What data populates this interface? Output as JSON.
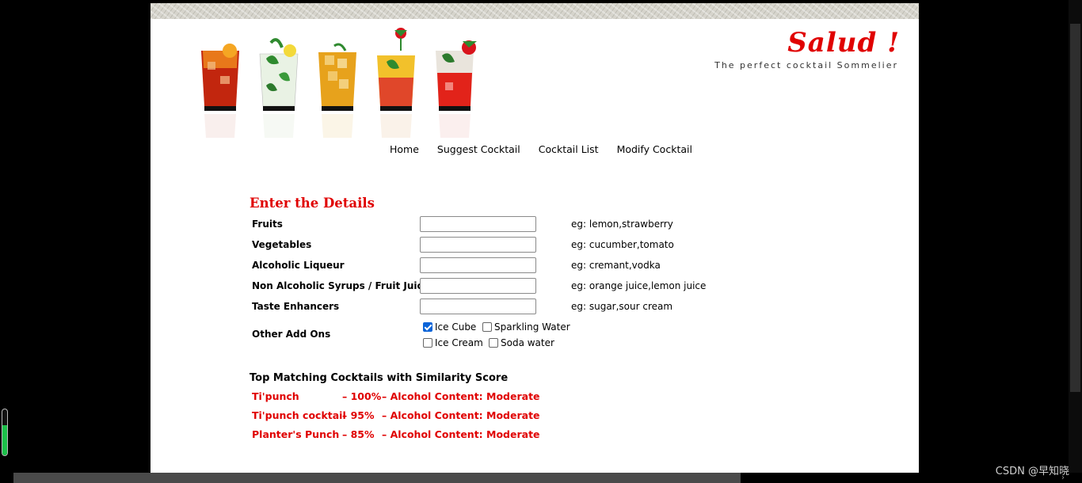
{
  "brand": {
    "title": "Salud !",
    "tagline": "The perfect cocktail Sommelier"
  },
  "nav": [
    "Home",
    "Suggest Cocktail",
    "Cocktail List",
    "Modify Cocktail"
  ],
  "form": {
    "heading": "Enter the Details",
    "fields": [
      {
        "label": "Fruits",
        "value": "",
        "hint": "eg: lemon,strawberry"
      },
      {
        "label": "Vegetables",
        "value": "",
        "hint": "eg: cucumber,tomato"
      },
      {
        "label": "Alcoholic Liqueur",
        "value": "",
        "hint": "eg: cremant,vodka"
      },
      {
        "label": "Non Alcoholic Syrups / Fruit Juices",
        "value": "",
        "hint": "eg: orange juice,lemon juice"
      },
      {
        "label": "Taste Enhancers",
        "value": "",
        "hint": "eg: sugar,sour cream"
      }
    ],
    "addons": {
      "label": "Other Add Ons",
      "options": [
        {
          "label": "Ice Cube",
          "checked": true
        },
        {
          "label": "Sparkling Water",
          "checked": false
        },
        {
          "label": "Ice Cream",
          "checked": false
        },
        {
          "label": "Soda water",
          "checked": false
        }
      ]
    }
  },
  "results": {
    "heading": "Top Matching Cocktails with Similarity Score",
    "items": [
      {
        "name": "Ti'punch",
        "score": "– 100%",
        "alcohol": "– Alcohol Content: Moderate"
      },
      {
        "name": "Ti'punch cocktail",
        "score": "– 95%",
        "alcohol": "– Alcohol Content: Moderate"
      },
      {
        "name": "Planter's Punch",
        "score": "– 85%",
        "alcohol": "– Alcohol Content: Moderate"
      }
    ]
  },
  "indicator_level": 0.65,
  "watermark": "CSDN @早知晓",
  "colors": {
    "accent": "#e00000",
    "checkbox": "#0a64d8"
  }
}
